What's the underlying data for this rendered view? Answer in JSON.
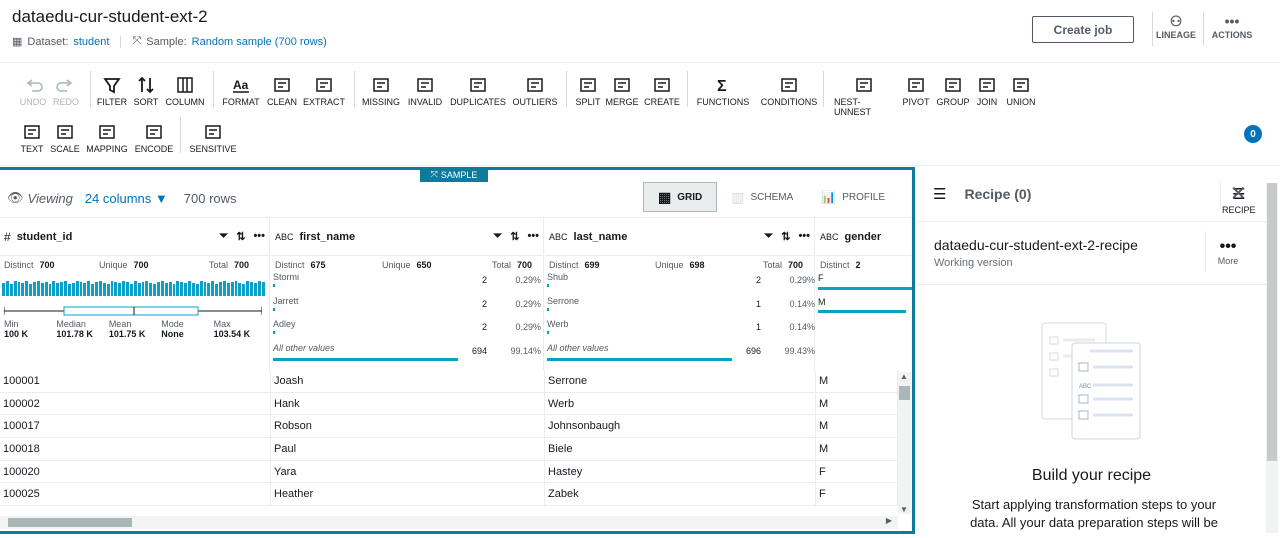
{
  "header": {
    "title": "dataedu-cur-student-ext-2",
    "dataset_label": "Dataset:",
    "dataset_value": "student",
    "sample_label": "Sample:",
    "sample_value": "Random sample (700 rows)",
    "create_job": "Create job",
    "lineage": "LINEAGE",
    "actions": "ACTIONS"
  },
  "toolbar": {
    "row1": [
      "UNDO",
      "REDO",
      "FILTER",
      "SORT",
      "COLUMN",
      "FORMAT",
      "CLEAN",
      "EXTRACT",
      "MISSING",
      "INVALID",
      "DUPLICATES",
      "OUTLIERS",
      "SPLIT",
      "MERGE",
      "CREATE",
      "FUNCTIONS",
      "CONDITIONS",
      "NEST-UNNEST",
      "PIVOT",
      "GROUP",
      "JOIN",
      "UNION"
    ],
    "row2": [
      "TEXT",
      "SCALE",
      "MAPPING",
      "ENCODE",
      "SENSITIVE"
    ],
    "recipe": "RECIPE",
    "recipe_count": "0"
  },
  "grid": {
    "sample_badge": "SAMPLE",
    "viewing": "Viewing",
    "columns_link": "24 columns",
    "rows": "700 rows",
    "tabs": [
      "GRID",
      "SCHEMA",
      "PROFILE"
    ]
  },
  "columns": [
    {
      "type": "#",
      "name": "student_id",
      "distinct_label": "Distinct",
      "distinct": "700",
      "unique_label": "Unique",
      "unique": "700",
      "total_label": "Total",
      "total": "700",
      "summary": [
        {
          "k": "Min",
          "v": "100 K"
        },
        {
          "k": "Median",
          "v": "101.78 K"
        },
        {
          "k": "Mean",
          "v": "101.75 K"
        },
        {
          "k": "Mode",
          "v": "None"
        },
        {
          "k": "Max",
          "v": "103.54 K"
        }
      ]
    },
    {
      "type": "ABC",
      "name": "first_name",
      "distinct_label": "Distinct",
      "distinct": "675",
      "unique_label": "Unique",
      "unique": "650",
      "total_label": "Total",
      "total": "700",
      "values": [
        {
          "name": "Stormi",
          "count": "2",
          "pct": "0.29%"
        },
        {
          "name": "Jarrett",
          "count": "2",
          "pct": "0.29%"
        },
        {
          "name": "Adley",
          "count": "2",
          "pct": "0.29%"
        },
        {
          "name": "All other values",
          "count": "694",
          "pct": "99.14%"
        }
      ]
    },
    {
      "type": "ABC",
      "name": "last_name",
      "distinct_label": "Distinct",
      "distinct": "699",
      "unique_label": "Unique",
      "unique": "698",
      "total_label": "Total",
      "total": "700",
      "values": [
        {
          "name": "Shub",
          "count": "2",
          "pct": "0.29%"
        },
        {
          "name": "Serrone",
          "count": "1",
          "pct": "0.14%"
        },
        {
          "name": "Werb",
          "count": "1",
          "pct": "0.14%"
        },
        {
          "name": "All other values",
          "count": "696",
          "pct": "99.43%"
        }
      ]
    },
    {
      "type": "ABC",
      "name": "gender",
      "distinct_label": "Distinct",
      "distinct": "2",
      "values": [
        {
          "name": "F"
        },
        {
          "name": "M"
        }
      ]
    }
  ],
  "rows": [
    [
      "100001",
      "Joash",
      "Serrone",
      "M"
    ],
    [
      "100002",
      "Hank",
      "Werb",
      "M"
    ],
    [
      "100017",
      "Robson",
      "Johnsonbaugh",
      "M"
    ],
    [
      "100018",
      "Paul",
      "Biele",
      "M"
    ],
    [
      "100020",
      "Yara",
      "Hastey",
      "F"
    ],
    [
      "100025",
      "Heather",
      "Zabek",
      "F"
    ]
  ],
  "recipe_panel": {
    "title": "Recipe (0)",
    "name": "dataedu-cur-student-ext-2-recipe",
    "version": "Working version",
    "more": "More",
    "build_title": "Build your recipe",
    "build_desc": "Start applying transformation steps to your data. All your data preparation steps will be"
  }
}
